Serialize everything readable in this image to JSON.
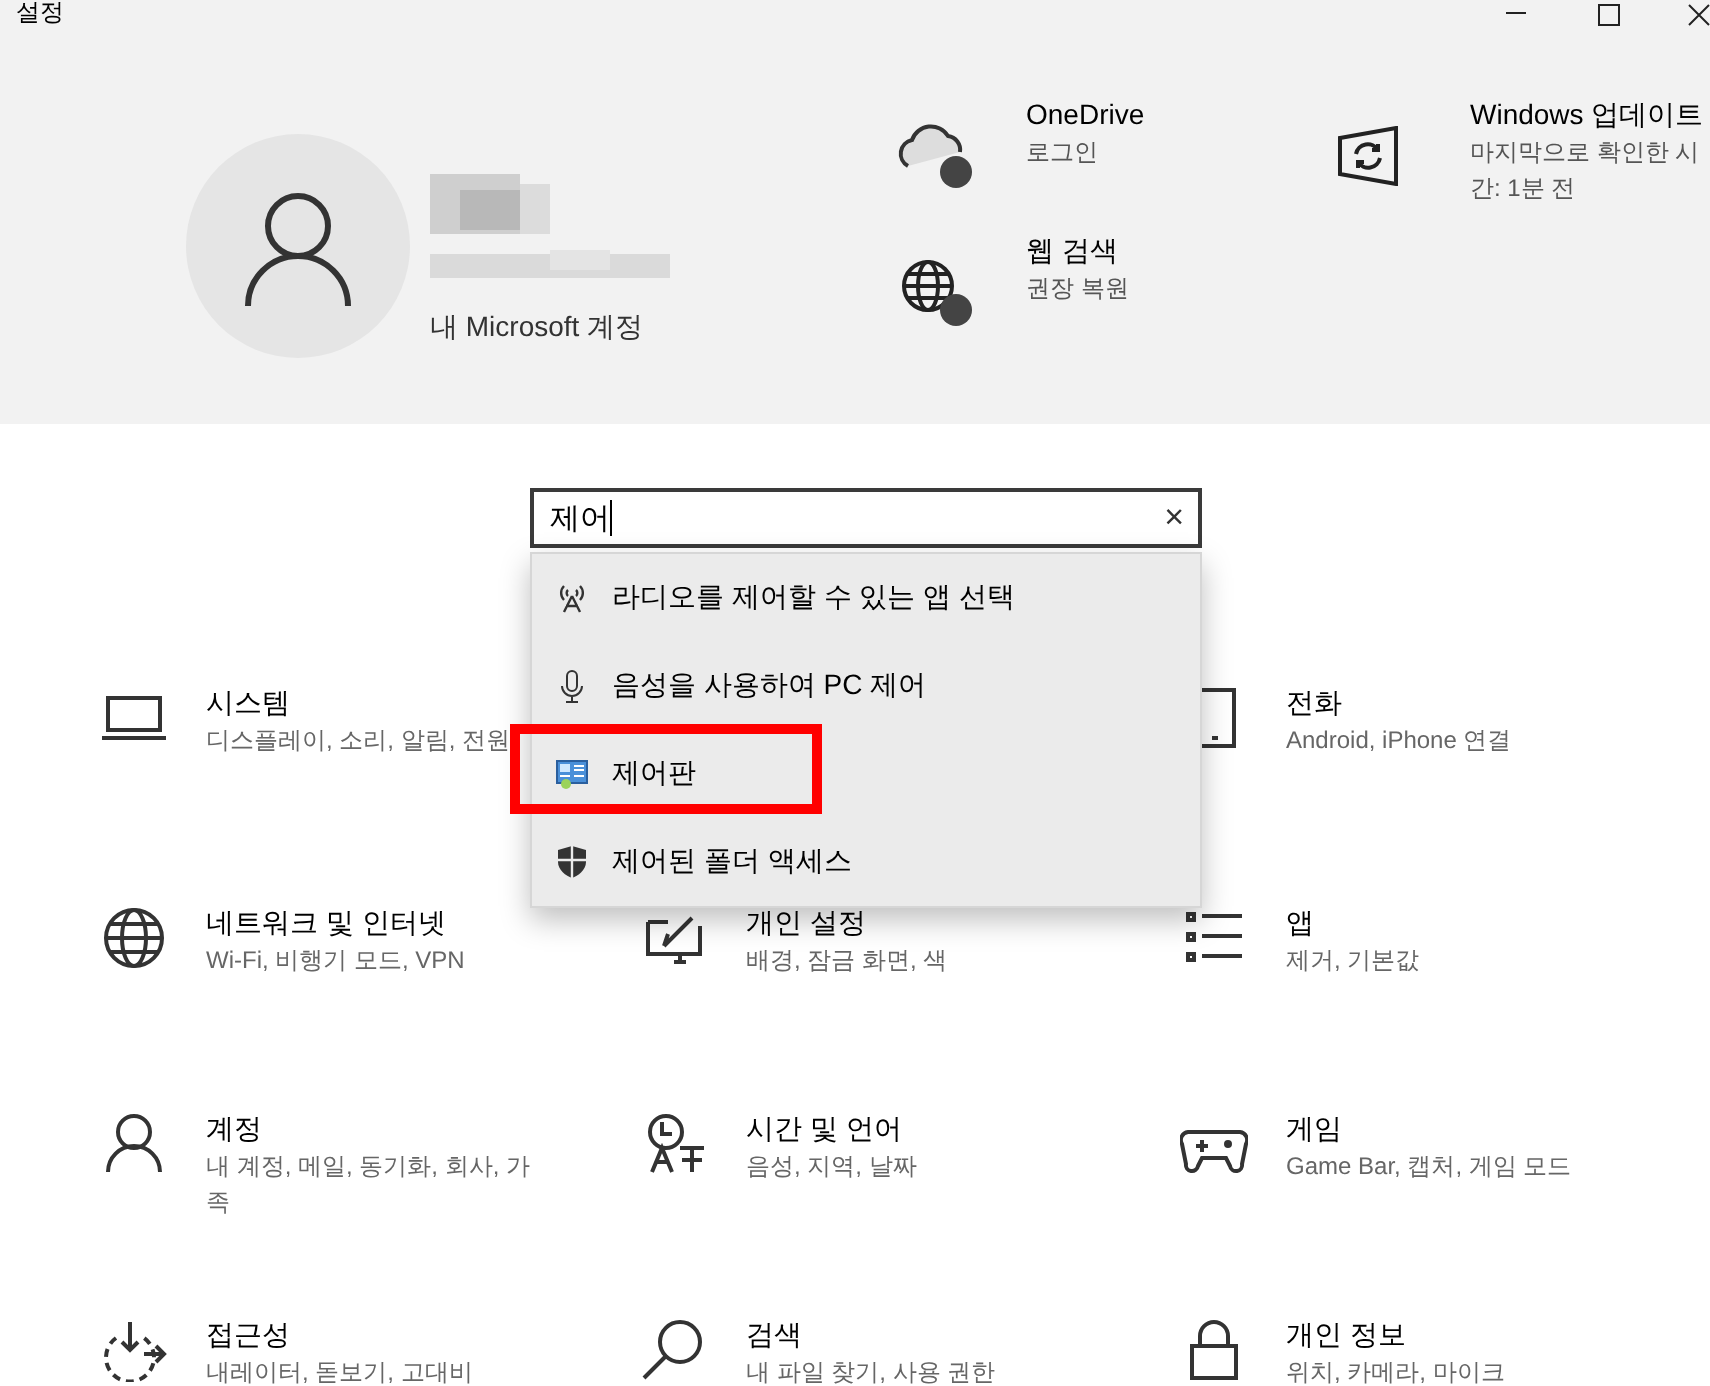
{
  "window": {
    "title": "설정"
  },
  "account": {
    "link": "내 Microsoft 계정"
  },
  "shortcuts": [
    {
      "title": "OneDrive",
      "lines": [
        "로그인"
      ]
    },
    {
      "title": "웹 검색",
      "lines": [
        "권장 복원"
      ]
    },
    {
      "title": "Windows 업데이트",
      "lines": [
        "마지막으로 확인한 시",
        "간: 1분 전"
      ]
    }
  ],
  "search": {
    "value": "제어",
    "clear": "×"
  },
  "suggestions": [
    {
      "label": "라디오를 제어할 수 있는 앱 선택",
      "highlighted": false
    },
    {
      "label": "음성을 사용하여 PC 제어",
      "highlighted": false
    },
    {
      "label": "제어판",
      "highlighted": true
    },
    {
      "label": "제어된 폴더 액세스",
      "highlighted": false
    }
  ],
  "categories": [
    {
      "column_1": {
        "title": "시스템",
        "lines": [
          "디스플레이, 소리, 알림, 전원"
        ]
      },
      "column_3": {
        "title": "전화",
        "lines": [
          "Android, iPhone 연결"
        ]
      }
    },
    {
      "column_1": {
        "title": "네트워크 및 인터넷",
        "lines": [
          "Wi-Fi, 비행기 모드, VPN"
        ]
      },
      "column_2": {
        "title": "개인 설정",
        "lines": [
          "배경, 잠금 화면, 색"
        ]
      },
      "column_3": {
        "title": "앱",
        "lines": [
          "제거, 기본값"
        ]
      }
    },
    {
      "column_1": {
        "title": "계정",
        "lines": [
          "내 계정, 메일, 동기화, 회사, 가",
          "족"
        ]
      },
      "column_2": {
        "title": "시간 및 언어",
        "lines": [
          "음성, 지역, 날짜"
        ]
      },
      "column_3": {
        "title": "게임",
        "lines": [
          "Game Bar, 캡처, 게임 모드"
        ]
      }
    },
    {
      "column_1": {
        "title": "접근성",
        "lines": [
          "내레이터, 돋보기, 고대비"
        ]
      },
      "column_2": {
        "title": "검색",
        "lines": [
          "내 파일 찾기, 사용 권한"
        ]
      },
      "column_3": {
        "title": "개인 정보",
        "lines": [
          "위치, 카메라, 마이크"
        ]
      }
    }
  ]
}
